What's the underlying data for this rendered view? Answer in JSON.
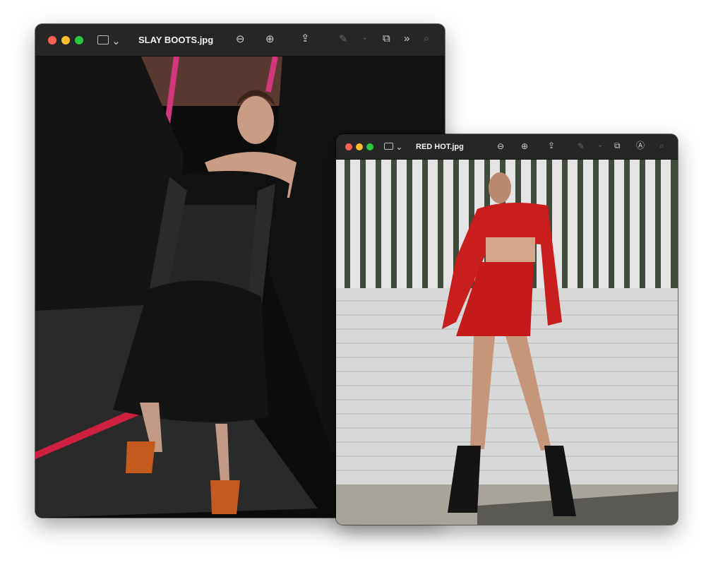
{
  "windows": [
    {
      "title": "SLAY BOOTS.jpg",
      "photo": "person in black off-shoulder dress and orange platform heels against black curtain"
    },
    {
      "title": "RED HOT.jpg",
      "photo": "person in red sequin crop top and skirt with black boots against white brick wall"
    }
  ],
  "colors": {
    "close": "#fe5f57",
    "minimize": "#febc2e",
    "zoom": "#28c840",
    "toolbar": "#262626"
  },
  "toolbar_icons": [
    "sidebar-icon",
    "zoom-out-icon",
    "zoom-in-icon",
    "share-icon",
    "markup-icon",
    "rotate-icon",
    "more-icon",
    "search-icon"
  ]
}
